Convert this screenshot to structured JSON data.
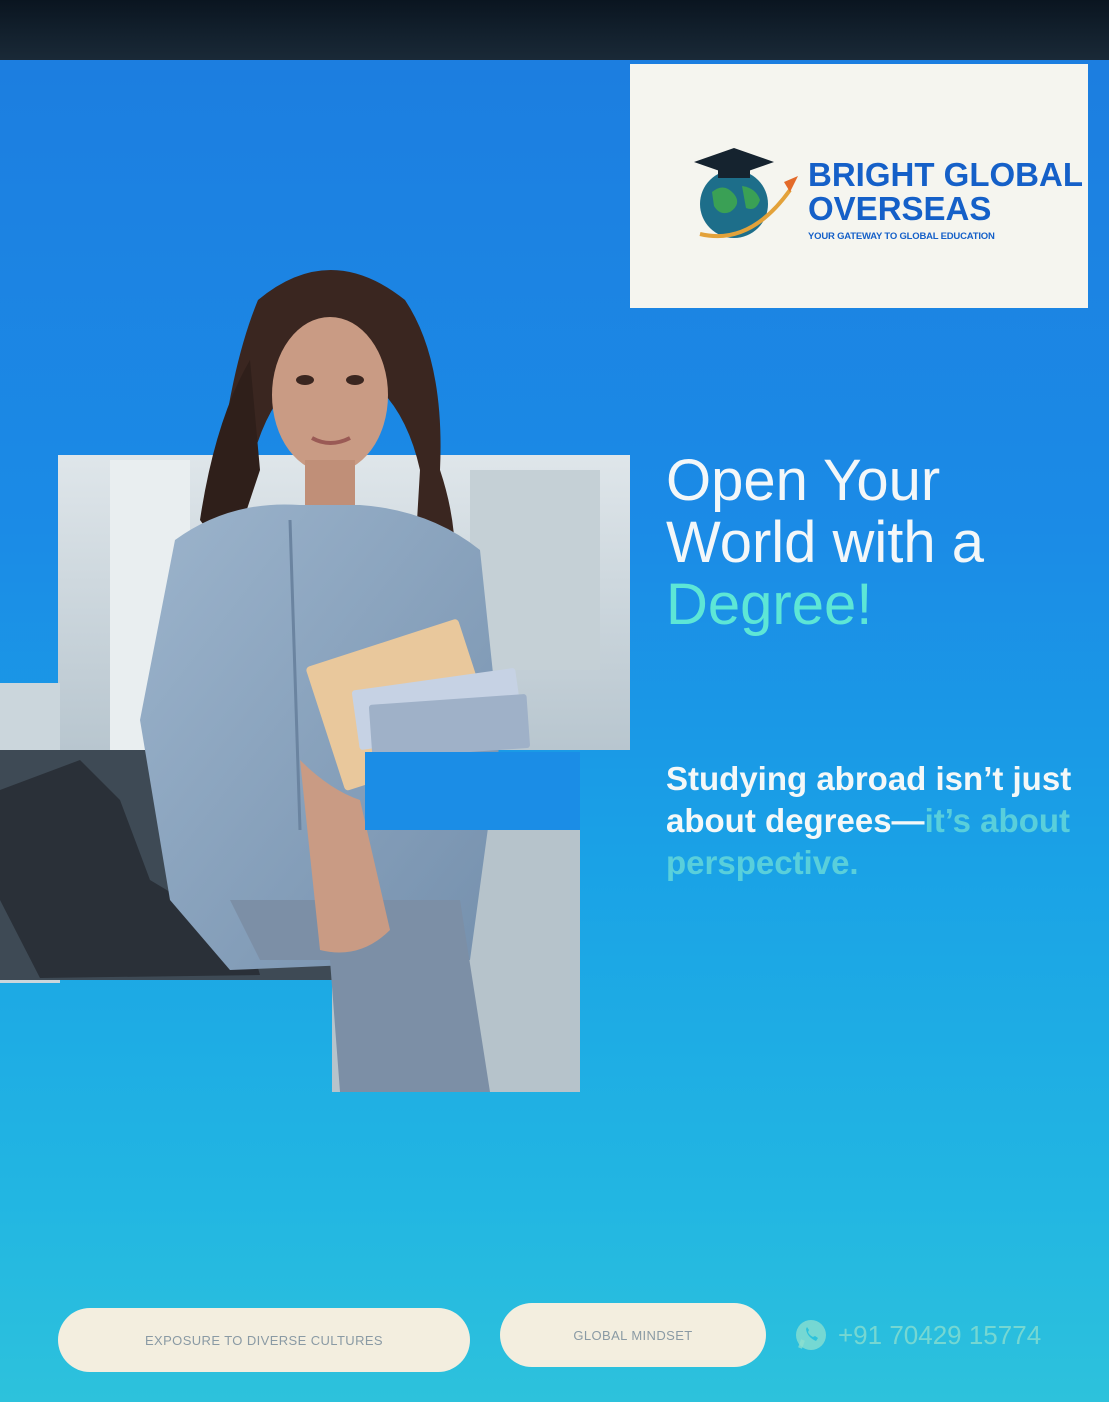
{
  "brand": {
    "name_line1": "BRIGHT GLOBAL",
    "name_line2": "OVERSEAS",
    "tagline": "YOUR GATEWAY TO GLOBAL EDUCATION"
  },
  "headline": {
    "line1": "Open Your",
    "line2": "World with a",
    "line3": "Degree!"
  },
  "body": {
    "part1": "Studying abroad isn’t just about degrees—",
    "part2": "it’s about perspective."
  },
  "pills": {
    "pill1": "EXPOSURE TO DIVERSE CULTURES",
    "pill2": "GLOBAL MINDSET"
  },
  "contact": {
    "phone": "+91 70429 15774"
  },
  "colors": {
    "accent_teal": "#5de6d6",
    "brand_blue": "#1560c8",
    "pill_bg": "#f3eedf"
  },
  "icons": [
    "graduation-globe-icon",
    "whatsapp-icon"
  ]
}
